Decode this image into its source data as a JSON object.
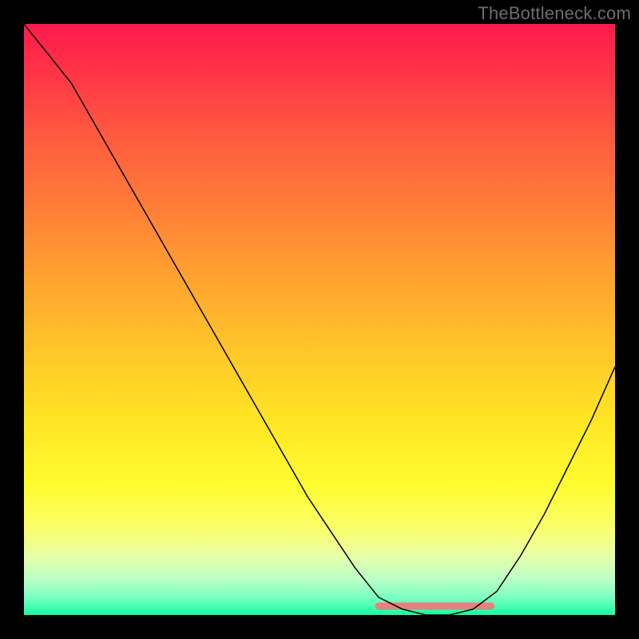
{
  "watermark": "TheBottleneck.com",
  "colors": {
    "page_bg": "#000000",
    "curve": "#000000",
    "zone_band": "#e68080",
    "gradient_top": "#ff1a4d",
    "gradient_bottom": "#0bff9e"
  },
  "chart_data": {
    "type": "line",
    "title": "",
    "xlabel": "",
    "ylabel": "",
    "xlim": [
      0,
      100
    ],
    "ylim": [
      0,
      100
    ],
    "grid": false,
    "legend": false,
    "background": "vertical rainbow gradient (red top → green bottom) representing bottleneck severity",
    "series": [
      {
        "name": "bottleneck-curve",
        "x": [
          0,
          4,
          8,
          12,
          16,
          20,
          24,
          28,
          32,
          36,
          40,
          44,
          48,
          52,
          56,
          60,
          64,
          68,
          72,
          76,
          80,
          84,
          88,
          92,
          96,
          100
        ],
        "y": [
          100,
          95,
          90,
          83,
          76,
          69,
          62,
          55,
          48,
          41,
          34,
          27,
          20,
          14,
          8,
          3,
          1,
          0,
          0,
          1,
          4,
          10,
          17,
          25,
          33,
          42
        ]
      }
    ],
    "optimal_zone": {
      "name": "optimal-band",
      "x_start": 60,
      "x_end": 79,
      "y": 1.5,
      "color": "#e68080"
    }
  }
}
